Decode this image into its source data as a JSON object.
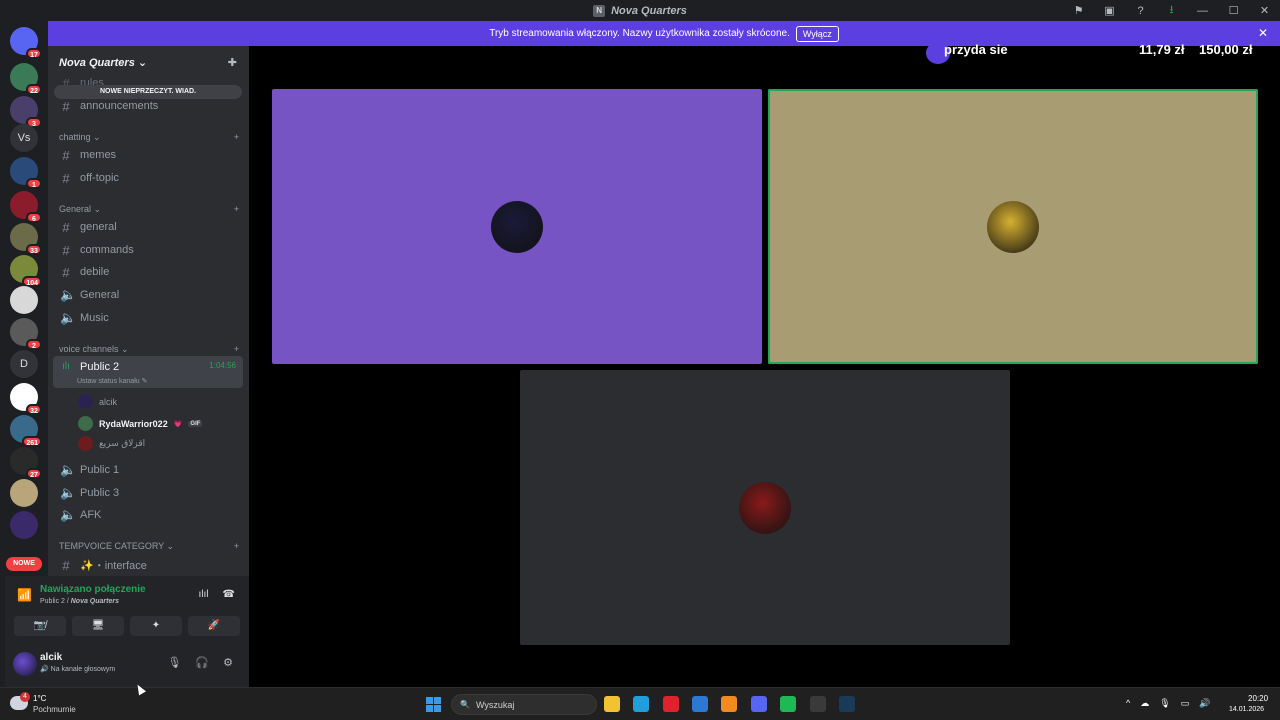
{
  "window": {
    "title": "Nova Quarters",
    "icons": [
      "flag-icon",
      "screen-icon",
      "help-icon",
      "download-icon",
      "minimize-icon",
      "maximize-icon",
      "close-icon"
    ],
    "icon_glyphs": [
      "⚑",
      "▣",
      "?",
      "⭳",
      "—",
      "☐",
      "✕"
    ]
  },
  "banner": {
    "text": "Tryb streamowania włączony. Nazwy użytkownika zostały skrócone.",
    "button": "Wyłącz"
  },
  "servers": [
    {
      "name": "home",
      "badge": "17",
      "color": "#5865f2"
    },
    {
      "name": "server-1",
      "badge": "22",
      "color": "#3b7a57"
    },
    {
      "name": "server-2",
      "badge": "3",
      "color": "#4a3f6b"
    },
    {
      "name": "server-vs",
      "text": "Vs",
      "badge": ""
    },
    {
      "name": "server-3",
      "badge": "1",
      "color": "#2a4b7a"
    },
    {
      "name": "server-4",
      "badge": "6",
      "color": "#8a1c2b"
    },
    {
      "name": "server-5",
      "badge": "33",
      "color": "#6b6b4a"
    },
    {
      "name": "server-6",
      "badge": "104",
      "color": "#7a8a3a"
    },
    {
      "name": "server-nova",
      "badge": "",
      "color": "#d8d8d8"
    },
    {
      "name": "server-7",
      "badge": "2",
      "color": "#5a5a5a"
    },
    {
      "name": "server-d",
      "text": "D",
      "badge": ""
    },
    {
      "name": "server-8",
      "badge": "32",
      "color": "#ffffff"
    },
    {
      "name": "server-9",
      "badge": "261",
      "color": "#3a6a8a"
    },
    {
      "name": "server-10",
      "badge": "27",
      "color": "#2a2a2a"
    },
    {
      "name": "server-11",
      "badge": "",
      "color": "#b8a57a"
    },
    {
      "name": "server-12",
      "badge": "",
      "color": "#3a2a6a"
    }
  ],
  "new_pill": "NOWE",
  "server_header": {
    "name": "Nova Quarters ⌄",
    "add_icon": "✚"
  },
  "unread_pill": "NOWE NIEPRZECZYT. WIAD.",
  "channels": {
    "rules": "rules",
    "announcements": "announcements",
    "cat_chatting": "chatting ⌄",
    "memes": "memes",
    "off_topic": "off-topic",
    "cat_general": "General ⌄",
    "general": "general",
    "commands": "commands",
    "debile": "debile",
    "general_voice": "General",
    "music": "Music",
    "cat_voice": "voice channels ⌄",
    "public2": "Public 2",
    "public2_timer": "1:04:56",
    "public2_status": "Ustaw status kanału ✎",
    "voice_users": [
      {
        "name": "alcik",
        "color": "#2a2350"
      },
      {
        "name": "RydaWarrior022",
        "color": "#3f6b4a",
        "bold": true,
        "tag": "💗",
        "gif": "GIF"
      },
      {
        "name": "اقزلاق سريع",
        "color": "#6b1c1c"
      }
    ],
    "public1": "Public 1",
    "public3": "Public 3",
    "afk": "AFK",
    "cat_tempvoice": "TEMPVOICE CATEGORY ⌄",
    "interface": "✨・interface",
    "plus": "+"
  },
  "voice_bar": {
    "status": "Nawiązano połączenie",
    "channel": "Public 2 / ",
    "server": "Nova Quarters",
    "right_icons": [
      "ılıl",
      "☎"
    ],
    "buttons": [
      "📷̸",
      "🖥",
      "✦",
      "🚀"
    ]
  },
  "user": {
    "name": "alcik",
    "status": "🔊 Na kanale głosowym",
    "icons": [
      "🎙",
      "🎧",
      "⚙"
    ]
  },
  "overlay": {
    "left_text": "przyda sie",
    "price1": "11,79 zł",
    "price2": "150,00 zł"
  },
  "tiles": [
    {
      "name": "tile-1",
      "bg": "#7654c4",
      "av": "#1a1a3a"
    },
    {
      "name": "tile-2",
      "bg": "#a89c72",
      "av": "#d8b030",
      "speaking": true
    },
    {
      "name": "tile-3",
      "bg": "#2b2d31",
      "av": "#8a1a1a"
    }
  ],
  "taskbar": {
    "temp": "1°C",
    "desc": "Pochmurnie",
    "weather_badge": "4",
    "search_placeholder": "Wyszukaj",
    "search_icon": "🔍",
    "apps": [
      {
        "name": "file-explorer-icon",
        "color": "#f1c232"
      },
      {
        "name": "edge-icon",
        "color": "#1f9edb"
      },
      {
        "name": "opera-icon",
        "color": "#e0222d"
      },
      {
        "name": "store-icon",
        "color": "#2b79d4"
      },
      {
        "name": "app-a-icon",
        "color": "#f28a20"
      },
      {
        "name": "discord-icon",
        "color": "#5865f2"
      },
      {
        "name": "spotify-icon",
        "color": "#1db954"
      },
      {
        "name": "app-red-icon",
        "color": "#3a3a3a"
      },
      {
        "name": "steam-icon",
        "color": "#1a3a5a"
      }
    ],
    "tray": [
      "^",
      "☁",
      "🎙",
      "▭",
      "🔊"
    ],
    "time": "20:20",
    "date": "14.01.2026"
  }
}
